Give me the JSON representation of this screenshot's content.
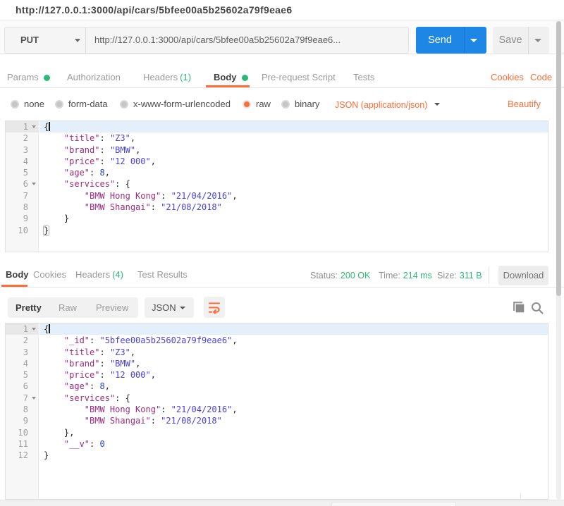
{
  "url_tab": {
    "title": "http://127.0.0.1:3000/api/cars/5bfee00a5b25602a79f9eae6"
  },
  "request_bar": {
    "method": "PUT",
    "url": "http://127.0.0.1:3000/api/cars/5bfee00a5b25602a79f9eae6...",
    "send_label": "Send",
    "save_label": "Save"
  },
  "request_tabs": [
    {
      "id": "params",
      "label": "Params",
      "dot": true
    },
    {
      "id": "authorization",
      "label": "Authorization"
    },
    {
      "id": "headers",
      "label": "Headers",
      "count": "(1)"
    },
    {
      "id": "body",
      "label": "Body",
      "dot": true,
      "active": true
    },
    {
      "id": "prerequest",
      "label": "Pre-request Script"
    },
    {
      "id": "tests",
      "label": "Tests"
    }
  ],
  "links": {
    "cookies": "Cookies",
    "code": "Code",
    "beautify": "Beautify"
  },
  "body_modes": [
    {
      "id": "none",
      "label": "none"
    },
    {
      "id": "form-data",
      "label": "form-data"
    },
    {
      "id": "urlencoded",
      "label": "x-www-form-urlencoded"
    },
    {
      "id": "raw",
      "label": "raw",
      "selected": true
    },
    {
      "id": "binary",
      "label": "binary"
    }
  ],
  "content_type": {
    "label": "JSON (application/json)"
  },
  "request_editor": {
    "active_line": 1,
    "cursor_line": 1,
    "fold_lines": [
      1,
      6
    ],
    "match_line": 10,
    "lines": [
      [
        [
          "p",
          "{"
        ]
      ],
      [
        [
          "p",
          "    "
        ],
        [
          "k",
          "\"title\""
        ],
        [
          "p",
          ": "
        ],
        [
          "s",
          "\"Z3\""
        ],
        [
          "p",
          ","
        ]
      ],
      [
        [
          "p",
          "    "
        ],
        [
          "k",
          "\"brand\""
        ],
        [
          "p",
          ": "
        ],
        [
          "s",
          "\"BMW\""
        ],
        [
          "p",
          ","
        ]
      ],
      [
        [
          "p",
          "    "
        ],
        [
          "k",
          "\"price\""
        ],
        [
          "p",
          ": "
        ],
        [
          "s",
          "\"12 000\""
        ],
        [
          "p",
          ","
        ]
      ],
      [
        [
          "p",
          "    "
        ],
        [
          "k",
          "\"age\""
        ],
        [
          "p",
          ": "
        ],
        [
          "n",
          "8"
        ],
        [
          "p",
          ","
        ]
      ],
      [
        [
          "p",
          "    "
        ],
        [
          "k",
          "\"services\""
        ],
        [
          "p",
          ": {"
        ]
      ],
      [
        [
          "p",
          "        "
        ],
        [
          "k",
          "\"BMW Hong Kong\""
        ],
        [
          "p",
          ": "
        ],
        [
          "s",
          "\"21/04/2016\""
        ],
        [
          "p",
          ","
        ]
      ],
      [
        [
          "p",
          "        "
        ],
        [
          "k",
          "\"BMW Shangai\""
        ],
        [
          "p",
          ": "
        ],
        [
          "s",
          "\"21/08/2018\""
        ]
      ],
      [
        [
          "p",
          "    }"
        ]
      ],
      [
        [
          "p",
          "}"
        ]
      ]
    ]
  },
  "response": {
    "tabs": [
      {
        "id": "body",
        "label": "Body",
        "active": true
      },
      {
        "id": "cookies",
        "label": "Cookies"
      },
      {
        "id": "headers",
        "label": "Headers",
        "count": "(4)"
      },
      {
        "id": "test-results",
        "label": "Test Results"
      }
    ],
    "status_items": [
      {
        "id": "status",
        "label": "Status:",
        "value": "200 OK"
      },
      {
        "id": "time",
        "label": "Time:",
        "value": "214 ms"
      },
      {
        "id": "size",
        "label": "Size:",
        "value": "311 B"
      }
    ],
    "download_label": "Download",
    "view_tabs": [
      {
        "id": "pretty",
        "label": "Pretty",
        "active": true
      },
      {
        "id": "raw",
        "label": "Raw"
      },
      {
        "id": "preview",
        "label": "Preview"
      }
    ],
    "format": "JSON",
    "editor": {
      "active_line": 1,
      "cursor_line": 1,
      "fold_lines": [
        1,
        7
      ],
      "match_line": 0,
      "lines": [
        [
          [
            "p",
            "{"
          ]
        ],
        [
          [
            "p",
            "    "
          ],
          [
            "k",
            "\"_id\""
          ],
          [
            "p",
            ": "
          ],
          [
            "s",
            "\"5bfee00a5b25602a79f9eae6\""
          ],
          [
            "p",
            ","
          ]
        ],
        [
          [
            "p",
            "    "
          ],
          [
            "k",
            "\"title\""
          ],
          [
            "p",
            ": "
          ],
          [
            "s",
            "\"Z3\""
          ],
          [
            "p",
            ","
          ]
        ],
        [
          [
            "p",
            "    "
          ],
          [
            "k",
            "\"brand\""
          ],
          [
            "p",
            ": "
          ],
          [
            "s",
            "\"BMW\""
          ],
          [
            "p",
            ","
          ]
        ],
        [
          [
            "p",
            "    "
          ],
          [
            "k",
            "\"price\""
          ],
          [
            "p",
            ": "
          ],
          [
            "s",
            "\"12 000\""
          ],
          [
            "p",
            ","
          ]
        ],
        [
          [
            "p",
            "    "
          ],
          [
            "k",
            "\"age\""
          ],
          [
            "p",
            ": "
          ],
          [
            "n",
            "8"
          ],
          [
            "p",
            ","
          ]
        ],
        [
          [
            "p",
            "    "
          ],
          [
            "k",
            "\"services\""
          ],
          [
            "p",
            ": {"
          ]
        ],
        [
          [
            "p",
            "        "
          ],
          [
            "k",
            "\"BMW Hong Kong\""
          ],
          [
            "p",
            ": "
          ],
          [
            "s",
            "\"21/04/2016\""
          ],
          [
            "p",
            ","
          ]
        ],
        [
          [
            "p",
            "        "
          ],
          [
            "k",
            "\"BMW Shangai\""
          ],
          [
            "p",
            ": "
          ],
          [
            "s",
            "\"21/08/2018\""
          ]
        ],
        [
          [
            "p",
            "    },"
          ]
        ],
        [
          [
            "p",
            "    "
          ],
          [
            "k",
            "\"__v\""
          ],
          [
            "p",
            ": "
          ],
          [
            "n",
            "0"
          ]
        ],
        [
          [
            "p",
            "}"
          ]
        ]
      ]
    }
  },
  "colors": {
    "accent_orange": "#ff6c37",
    "success_green": "#2bb878",
    "send_blue": "#1e87e5",
    "key_token": "#9e2b7d",
    "string_token": "#4a41dd",
    "number_token": "#2b45c8"
  }
}
